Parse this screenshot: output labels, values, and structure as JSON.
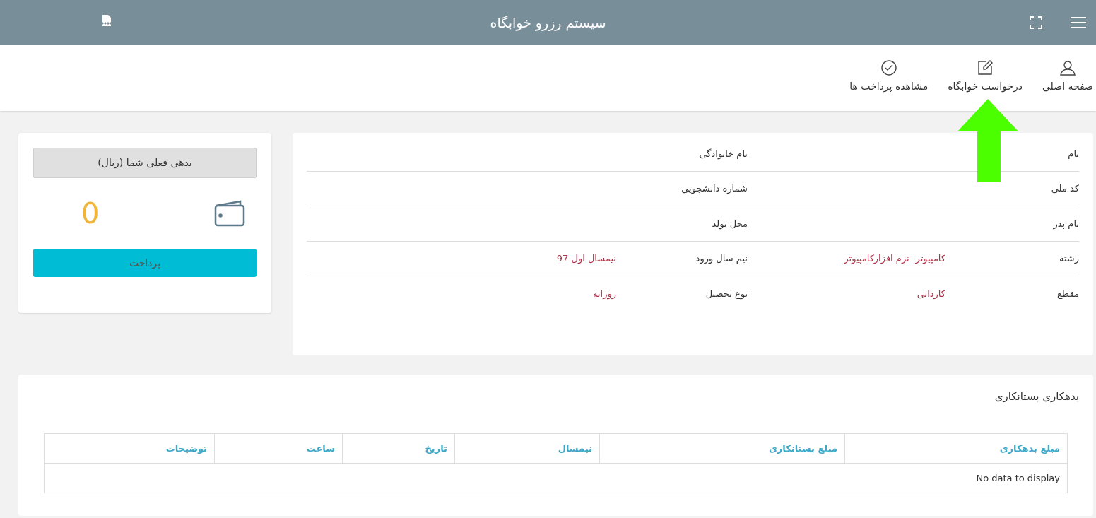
{
  "header": {
    "title": "سیستم رزرو خوابگاه"
  },
  "nav": [
    {
      "label": "صفحه اصلی"
    },
    {
      "label": "درخواست خوابگاه"
    },
    {
      "label": "مشاهده پرداخت ها"
    }
  ],
  "profile": {
    "rows": [
      {
        "label_1": "نام",
        "label_2": "نام خانوادگی"
      },
      {
        "label_1": "کد ملی",
        "label_2": "شماره دانشجویی"
      },
      {
        "label_1": "نام پدر",
        "label_2": "محل تولد"
      },
      {
        "label_1": "رشته",
        "value_1": "کامپیوتر- نرم افزارکامپیوتر",
        "label_2": "نیم سال ورود",
        "value_2": "نیمسال اول 97"
      },
      {
        "label_1": "مقطع",
        "value_1": "کاردانی",
        "label_2": "نوع تحصیل",
        "value_2": "روزانه"
      }
    ]
  },
  "debt": {
    "heading": "بدهی فعلی شما (ریال)",
    "amount": "0",
    "pay_button": "پرداخت"
  },
  "ledger": {
    "title": "بدهکاری بستانکاری",
    "columns": [
      "مبلغ بدهکاری",
      "مبلغ بستانکاری",
      "نیمسال",
      "تاریخ",
      "ساعت",
      "توضیحات"
    ],
    "empty_message": "No data to display"
  }
}
